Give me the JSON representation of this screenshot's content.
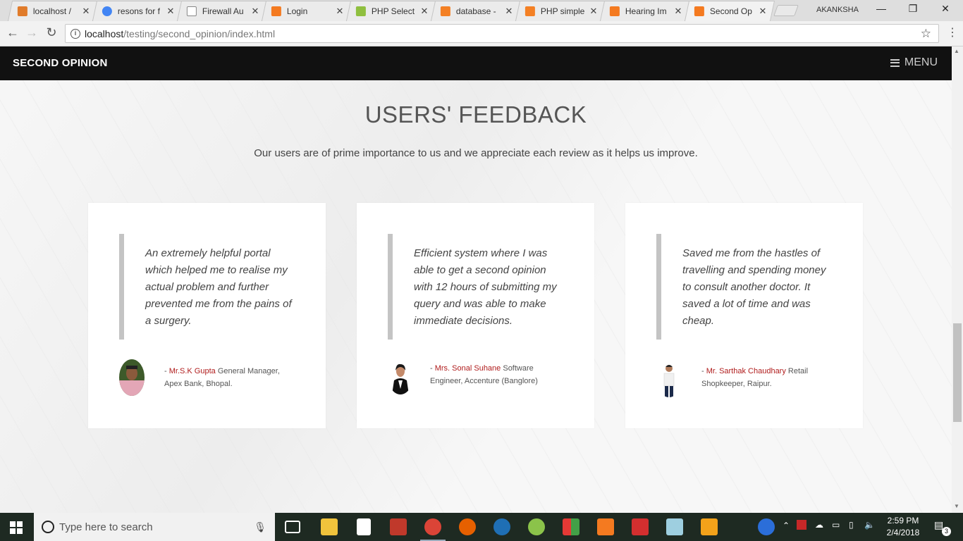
{
  "browser": {
    "tabs": [
      {
        "title": "localhost /",
        "favicon_color": "#e07b2a",
        "active": false
      },
      {
        "title": "resons for f",
        "favicon_color": "#4285f4",
        "active": false
      },
      {
        "title": "Firewall Au",
        "favicon_color": "#888888",
        "active": false
      },
      {
        "title": "Login",
        "favicon_color": "#f47a20",
        "active": false
      },
      {
        "title": "PHP Select",
        "favicon_color": "#8fbf3f",
        "active": false
      },
      {
        "title": "database -",
        "favicon_color": "#f48024",
        "active": false
      },
      {
        "title": "PHP simple",
        "favicon_color": "#f48024",
        "active": false
      },
      {
        "title": "Hearing Im",
        "favicon_color": "#f47a20",
        "active": false
      },
      {
        "title": "Second Op",
        "favicon_color": "#f47a20",
        "active": true
      }
    ],
    "profile_name": "AKANKSHA",
    "url_host": "localhost",
    "url_path": "/testing/second_opinion/index.html"
  },
  "site": {
    "brand": "SECOND OPINION",
    "menu_label": "MENU",
    "section_title": "USERS' FEEDBACK",
    "section_lead": "Our users are of prime importance to us and we appreciate each review as it helps us improve.",
    "testimonials": [
      {
        "quote": "An extremely helpful portal which helped me to realise my actual problem and further prevented me from the pains of a surgery.",
        "dash": "- ",
        "name": "Mr.S.K Gupta",
        "role": " General Manager, Apex Bank, Bhopal."
      },
      {
        "quote": "Efficient system where I was able to get a second opinion with 12 hours of submitting my query and was able to make immediate decisions.",
        "dash": "- ",
        "name": "Mrs. Sonal Suhane",
        "role": " Software Engineer, Accenture (Banglore)"
      },
      {
        "quote": "Saved me from the hastles of travelling and spending money to consult another doctor. It saved a lot of time and was cheap.",
        "dash": "- ",
        "name": "Mr. Sarthak Chaudhary",
        "role": " Retail Shopkeeper, Raipur."
      }
    ]
  },
  "taskbar": {
    "search_placeholder": "Type here to search",
    "time": "2:59 PM",
    "date": "2/4/2018",
    "notification_count": "3"
  }
}
